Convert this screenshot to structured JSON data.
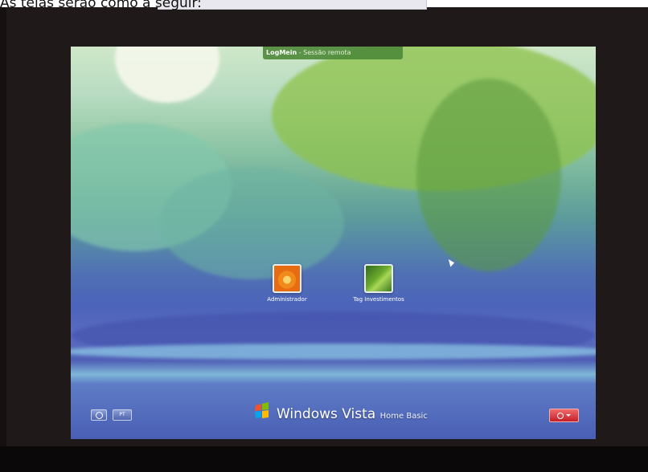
{
  "caption": "As telas serão como a seguir:",
  "session_bar": {
    "app_name": "LogMein",
    "separator": " - ",
    "session_label": "Sessão remota"
  },
  "users": [
    {
      "name": "Administrador",
      "icon": "flower-tile-icon"
    },
    {
      "name": "Tag Investimentos",
      "icon": "leaf-tile-icon"
    }
  ],
  "footer": {
    "ease_icon": "ease-of-access-icon",
    "language_code": "PT",
    "brand_name": "Windows Vista",
    "brand_edition": "Home Basic",
    "power_icon": "power-icon",
    "options_icon": "chevron-down-icon"
  },
  "colors": {
    "frame": "#1f1a19",
    "session_bar": "#4e8a3a",
    "power_button": "#c61f28"
  }
}
